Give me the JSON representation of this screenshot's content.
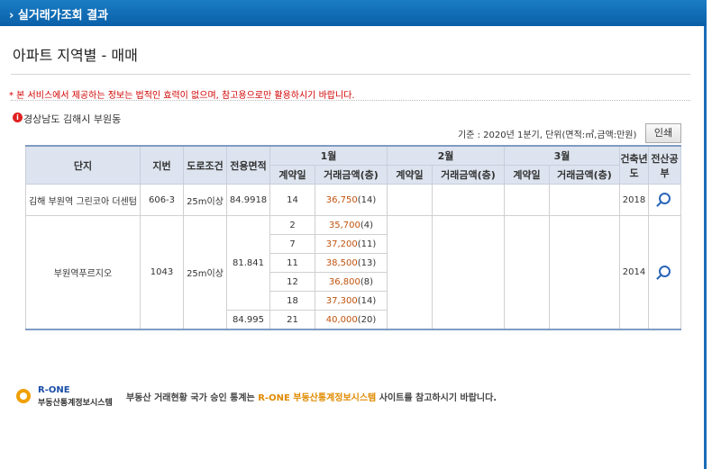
{
  "header": {
    "title": "› 실거래가조회 결과"
  },
  "page_title": "아파트 지역별 - 매매",
  "notice": "* 본 서비스에서 제공하는 정보는 법적인 효력이 없으며, 참고용으로만 활용하시기 바랍니다.",
  "location": "경상남도 김해시 부원동",
  "basis": "기준 : 2020년 1분기, 단위(면적:㎡,금액:만원)",
  "print_label": "인쇄",
  "table": {
    "headers": {
      "complex": "단지",
      "lot": "지번",
      "road": "도로조건",
      "area": "전용면적",
      "m1": "1월",
      "m2": "2월",
      "m3": "3월",
      "contract": "계약일",
      "price": "거래금액(층)",
      "built": "건축년도",
      "ledger": "전산공부"
    },
    "rows": [
      {
        "complex": "김해 부원역 그린코아 더센텀",
        "lot": "606-3",
        "road": "25m이상",
        "area": "84.9918",
        "day": "14",
        "amount": "36,750",
        "floor": "(14)",
        "built": "2018"
      },
      {
        "complex": "부원역푸르지오",
        "lot": "1043",
        "road": "25m이상",
        "area": "81.841",
        "day": "2",
        "amount": "35,700",
        "floor": "(4)",
        "built": "2014"
      },
      {
        "day": "7",
        "amount": "37,200",
        "floor": "(11)"
      },
      {
        "day": "11",
        "amount": "38,500",
        "floor": "(13)"
      },
      {
        "day": "12",
        "amount": "36,800",
        "floor": "(8)"
      },
      {
        "day": "18",
        "amount": "37,300",
        "floor": "(14)"
      },
      {
        "area": "84.995",
        "day": "21",
        "amount": "40,000",
        "floor": "(20)"
      }
    ]
  },
  "footer": {
    "logo_line1": "R-ONE",
    "logo_line2": "부동산통계정보시스템",
    "text_a": "부동산 거래현황 국가 승인 통계는 ",
    "text_hl": "R-ONE 부동산통계정보시스템",
    "text_b": " 사이트를 참고하시기 바랍니다."
  },
  "colors": {
    "header_bg": "#0a60a8",
    "amount": "#c0530d",
    "notice": "#d10000",
    "highlight": "#e08a00"
  }
}
